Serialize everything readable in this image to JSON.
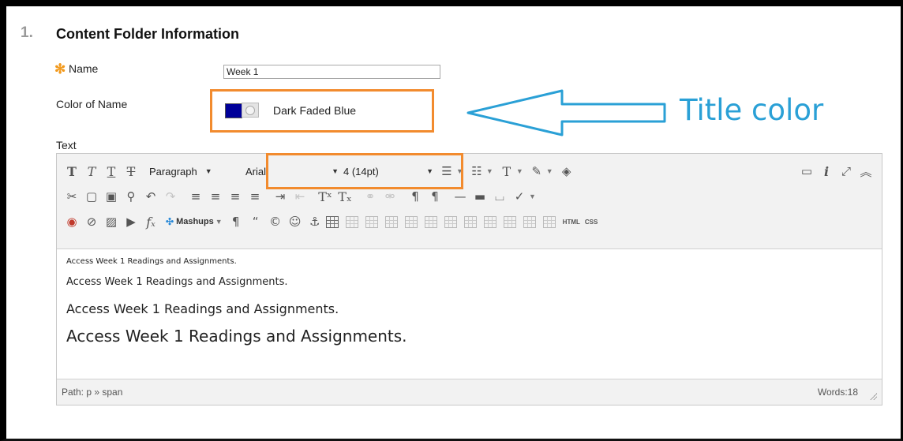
{
  "section": {
    "number": "1.",
    "title": "Content Folder Information"
  },
  "form": {
    "required_mark": "✻",
    "name_label": "Name",
    "name_value": "Week 1",
    "color_label": "Color of Name",
    "color_value_name": "Dark Faded Blue",
    "color_value_hex": "#000099",
    "text_label": "Text"
  },
  "annotation": {
    "label": "Title color",
    "color": "#2aa0d6",
    "highlight_color": "#f28b2e"
  },
  "toolbar": {
    "paragraph": "Paragraph",
    "font_family": "Arial",
    "font_size": "4 (14pt)",
    "mashups": "Mashups",
    "html_label": "HTML",
    "css_label": "CSS"
  },
  "content": {
    "lines": [
      "Access Week 1 Readings and Assignments.",
      "Access Week 1 Readings and Assignments.",
      "Access Week 1 Readings and Assignments.",
      "Access Week 1 Readings and Assignments."
    ]
  },
  "footer": {
    "path": "Path: p » span",
    "words": "Words:18"
  }
}
